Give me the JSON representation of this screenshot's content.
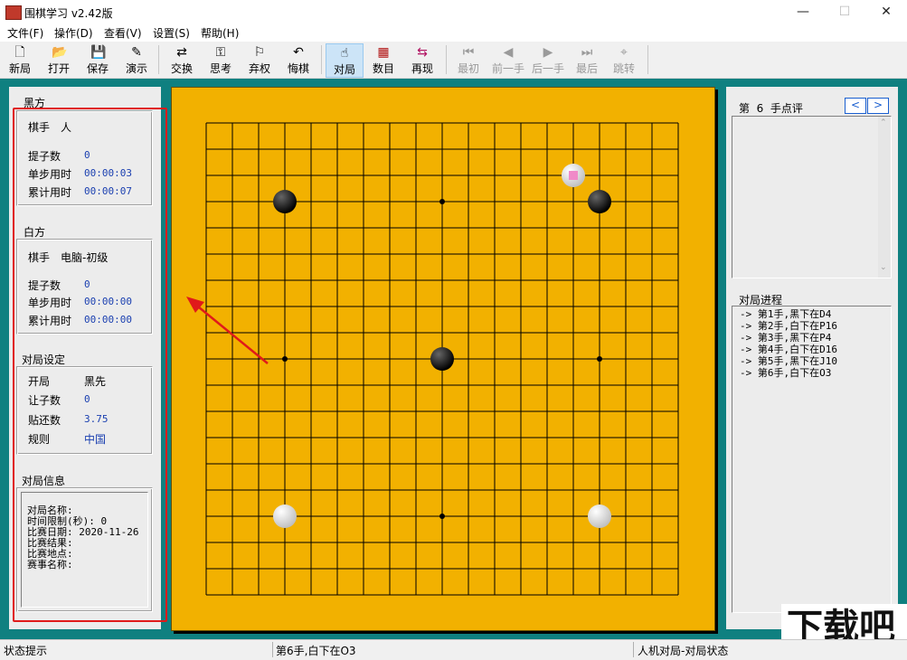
{
  "window": {
    "title": "围棋学习 v2.42版",
    "minimize": "—",
    "maximize": "☐",
    "close": "✕"
  },
  "menu": [
    "文件(F)",
    "操作(D)",
    "查看(V)",
    "设置(S)",
    "帮助(H)"
  ],
  "toolbar": {
    "new": "新局",
    "open": "打开",
    "save": "保存",
    "demo": "演示",
    "swap": "交换",
    "think": "思考",
    "resign": "弃权",
    "undo": "悔棋",
    "game": "对局",
    "count": "数目",
    "replay": "再现",
    "first": "最初",
    "prev": "前一手",
    "next": "后一手",
    "last": "最后",
    "jump": "跳转"
  },
  "black": {
    "header": "黑方",
    "player_label": "棋手",
    "player": "人",
    "captures_label": "提子数",
    "captures": "0",
    "step_label": "单步用时",
    "step": "00:00:03",
    "total_label": "累计用时",
    "total": "00:00:07"
  },
  "white": {
    "header": "白方",
    "player_label": "棋手",
    "player": "电脑-初级",
    "captures_label": "提子数",
    "captures": "0",
    "step_label": "单步用时",
    "step": "00:00:00",
    "total_label": "累计用时",
    "total": "00:00:00"
  },
  "settings": {
    "header": "对局设定",
    "opening_label": "开局",
    "opening": "黑先",
    "handicap_label": "让子数",
    "handicap": "0",
    "komi_label": "贴还数",
    "komi": "3.75",
    "rules_label": "规则",
    "rules": "中国"
  },
  "info": {
    "header": "对局信息",
    "lines": [
      "对局名称:",
      "时间限制(秒): 0",
      "比赛日期: 2020-11-26",
      "比赛结果:",
      "比赛地点:",
      "赛事名称:"
    ]
  },
  "comment": {
    "title": "第  6  手点评",
    "prev": "<",
    "next": ">"
  },
  "progress": {
    "header": "对局进程",
    "moves": [
      "-> 第1手,黑下在D4",
      "-> 第2手,白下在P16",
      "-> 第3手,黑下在P4",
      "-> 第4手,白下在D16",
      "-> 第5手,黑下在J10",
      "-> 第6手,白下在O3"
    ]
  },
  "board": {
    "size": 19,
    "stones": [
      {
        "color": "black",
        "col": 3,
        "row": 3
      },
      {
        "color": "white",
        "col": 14,
        "row": 2,
        "last": true
      },
      {
        "color": "black",
        "col": 15,
        "row": 3
      },
      {
        "color": "black",
        "col": 9,
        "row": 9
      },
      {
        "color": "white",
        "col": 3,
        "row": 15
      },
      {
        "color": "white",
        "col": 15,
        "row": 15
      }
    ],
    "colors": {
      "board": "#f2b100",
      "line": "#000000",
      "last_marker": "#f08ac8"
    }
  },
  "status": {
    "hint": "状态提示",
    "move": "第6手,白下在O3",
    "mode": "人机对局-对局状态"
  },
  "watermark": "下载吧"
}
